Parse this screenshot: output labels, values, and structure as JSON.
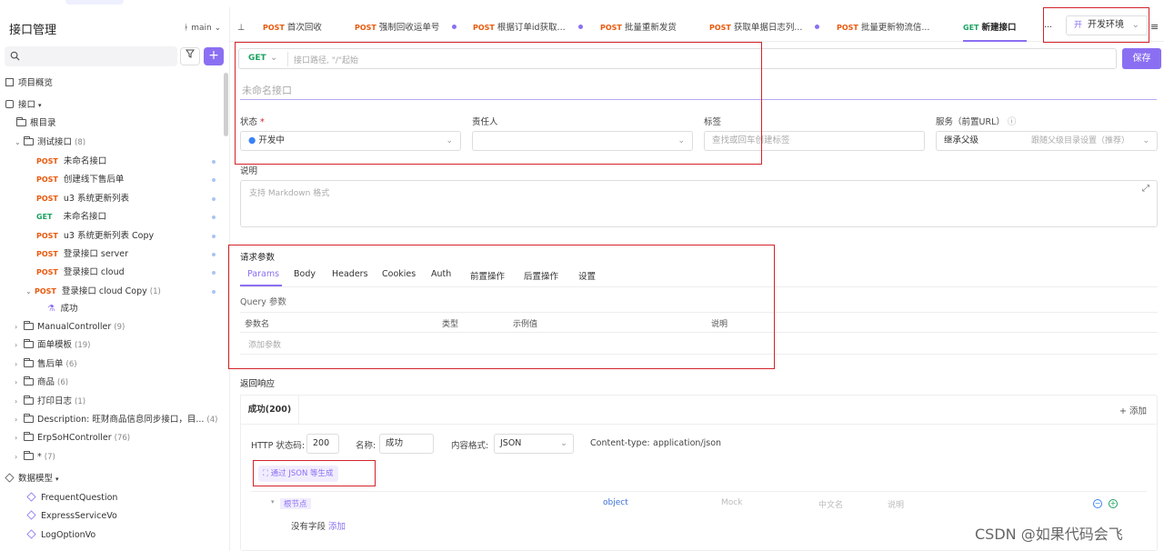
{
  "sidebar": {
    "title": "接口管理",
    "branch": "main",
    "overview": "项目概览",
    "api_root": "接口",
    "root_dir": "根目录",
    "folder_test": {
      "label": "测试接口",
      "count": "(8)"
    },
    "endpoints": [
      {
        "method": "POST",
        "label": "未命名接口"
      },
      {
        "method": "POST",
        "label": "创建线下售后单"
      },
      {
        "method": "POST",
        "label": "u3 系统更新列表"
      },
      {
        "method": "GET",
        "label": "未命名接口"
      },
      {
        "method": "POST",
        "label": "u3 系统更新列表 Copy"
      },
      {
        "method": "POST",
        "label": "登录接口 server"
      },
      {
        "method": "POST",
        "label": "登录接口 cloud"
      },
      {
        "method": "POST",
        "label": "登录接口 cloud Copy",
        "count": "(1)"
      }
    ],
    "case_success": "成功",
    "folders": [
      {
        "label": "ManualController",
        "count": "(9)"
      },
      {
        "label": "面单模板",
        "count": "(19)"
      },
      {
        "label": "售后单",
        "count": "(6)"
      },
      {
        "label": "商品",
        "count": "(6)"
      },
      {
        "label": "打印日志",
        "count": "(1)"
      },
      {
        "label": "Description: 旺财商品信息同步接口，目...",
        "count": "(4)"
      },
      {
        "label": "ErpSoHController",
        "count": "(76)"
      },
      {
        "label": "*",
        "count": "(7)"
      }
    ],
    "models_title": "数据模型",
    "models": [
      "FrequentQuestion",
      "ExpressServiceVo",
      "LogOptionVo"
    ]
  },
  "tabs": [
    {
      "method": "POST",
      "label": "首次回收",
      "dot": false
    },
    {
      "method": "POST",
      "label": "强制回收运单号",
      "dot": true
    },
    {
      "method": "POST",
      "label": "根据订单id获取...",
      "dot": true
    },
    {
      "method": "POST",
      "label": "批量重新发货",
      "dot": false
    },
    {
      "method": "POST",
      "label": "获取单据日志列...",
      "dot": true
    },
    {
      "method": "POST",
      "label": "批量更新物流信...",
      "dot": false
    },
    {
      "method": "GET",
      "label": "新建接口",
      "dot": false
    }
  ],
  "env": {
    "tag": "开",
    "label": "开发环境"
  },
  "request": {
    "method": "GET",
    "url_placeholder": "接口路径, \"/\"起始",
    "save_label": "保存",
    "name_placeholder": "未命名接口",
    "status_label": "状态",
    "status_required": "*",
    "status_value": "开发中",
    "owner_label": "责任人",
    "tags_label": "标签",
    "tags_placeholder": "查找或回车创建标签",
    "service_label": "服务（前置URL）",
    "service_value": "继承父级",
    "service_hint": "跟随父级目录设置（推荐）",
    "desc_label": "说明",
    "desc_placeholder": "支持 Markdown 格式"
  },
  "params": {
    "title": "请求参数",
    "tabs": [
      "Params",
      "Body",
      "Headers",
      "Cookies",
      "Auth",
      "前置操作",
      "后置操作",
      "设置"
    ],
    "query_label": "Query 参数",
    "columns": [
      "参数名",
      "类型",
      "示例值",
      "说明"
    ],
    "add_placeholder": "添加参数"
  },
  "response": {
    "title": "返回响应",
    "tab": "成功(200)",
    "add_label": "添加",
    "status_code_label": "HTTP 状态码:",
    "status_code": "200",
    "name_label": "名称:",
    "name_value": "成功",
    "content_format_label": "内容格式:",
    "content_format": "JSON",
    "content_type_label": "Content-type:",
    "content_type": "application/json",
    "gen_label": "通过 JSON 等生成",
    "root_node": "根节点",
    "root_type": "object",
    "mock_label": "Mock",
    "cn_name_label": "中文名",
    "desc_label": "说明",
    "no_fields": "没有字段",
    "add_link": "添加"
  },
  "watermark": "CSDN @如果代码会飞",
  "colors": {
    "accent": "#8b6ff2",
    "post": "#e8590c",
    "get": "#1aa260",
    "highlight": "#d2232a"
  }
}
